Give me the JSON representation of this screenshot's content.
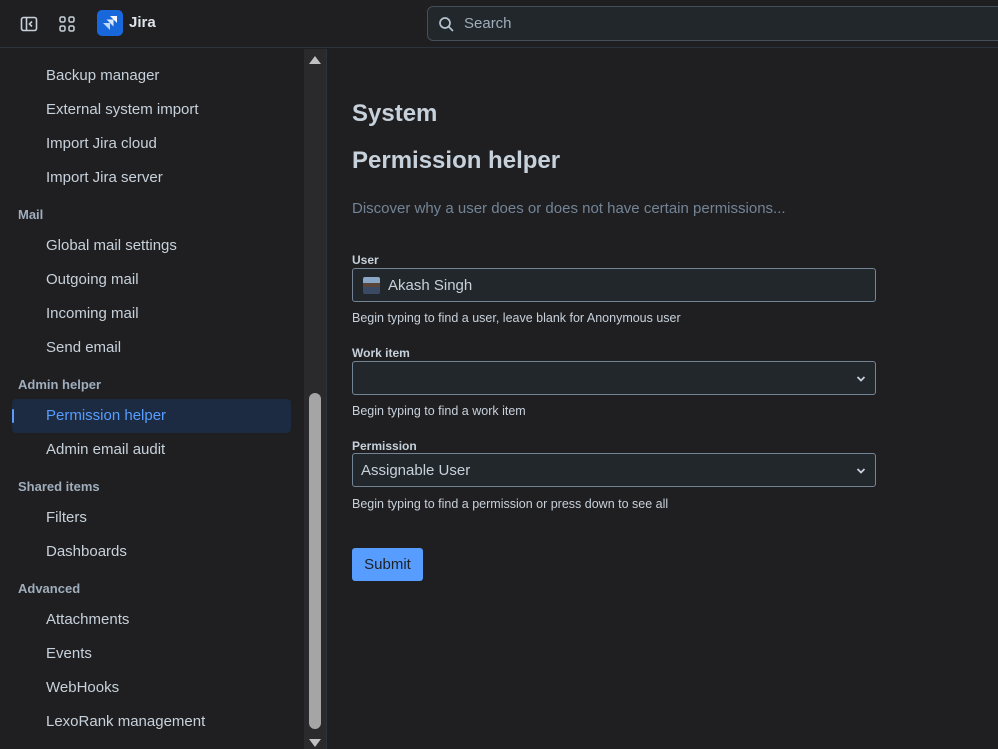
{
  "topbar": {
    "app_name": "Jira",
    "search_placeholder": "Search"
  },
  "sidebar": {
    "sections": [
      {
        "heading": "",
        "items": [
          {
            "label": "Backup manager"
          },
          {
            "label": "External system import"
          },
          {
            "label": "Import Jira cloud"
          },
          {
            "label": "Import Jira server"
          }
        ]
      },
      {
        "heading": "Mail",
        "items": [
          {
            "label": "Global mail settings"
          },
          {
            "label": "Outgoing mail"
          },
          {
            "label": "Incoming mail"
          },
          {
            "label": "Send email"
          }
        ]
      },
      {
        "heading": "Admin helper",
        "items": [
          {
            "label": "Permission helper",
            "selected": true
          },
          {
            "label": "Admin email audit"
          }
        ]
      },
      {
        "heading": "Shared items",
        "items": [
          {
            "label": "Filters"
          },
          {
            "label": "Dashboards"
          }
        ]
      },
      {
        "heading": "Advanced",
        "items": [
          {
            "label": "Attachments"
          },
          {
            "label": "Events"
          },
          {
            "label": "WebHooks"
          },
          {
            "label": "LexoRank management"
          }
        ]
      }
    ]
  },
  "main": {
    "section_title": "System",
    "page_title": "Permission helper",
    "description": "Discover why a user does or does not have certain permissions...",
    "user": {
      "label": "User",
      "value": "Akash Singh",
      "help": "Begin typing to find a user, leave blank for Anonymous user"
    },
    "work_item": {
      "label": "Work item",
      "value": "",
      "help": "Begin typing to find a work item"
    },
    "permission": {
      "label": "Permission",
      "value": "Assignable User",
      "help": "Begin typing to find a permission or press down to see all"
    },
    "submit_label": "Submit"
  },
  "colors": {
    "background": "#1f1f21",
    "accent": "#579dff",
    "selected_bg": "#1c2b41",
    "logo": "#1868db"
  }
}
